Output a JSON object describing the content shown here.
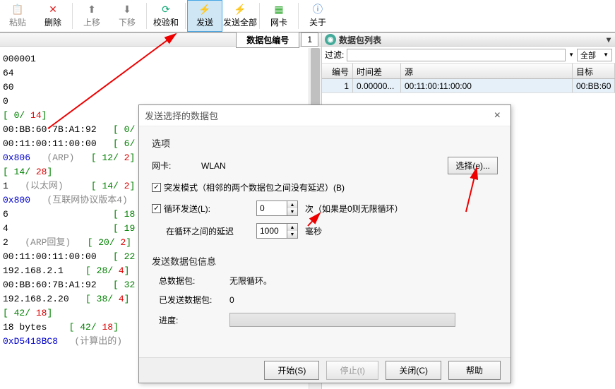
{
  "toolbar": {
    "paste": "粘贴",
    "delete": "删除",
    "moveup": "上移",
    "movedown": "下移",
    "checksum": "校验和",
    "send": "发送",
    "sendall": "发送全部",
    "nic": "网卡",
    "about": "关于"
  },
  "packet_bar": {
    "label": "数据包编号",
    "value": "1"
  },
  "hex_lines": [
    {
      "segs": [
        {
          "t": "000001",
          "c": "blk"
        }
      ]
    },
    {
      "segs": [
        {
          "t": "64",
          "c": "blk"
        }
      ]
    },
    {
      "segs": [
        {
          "t": "60",
          "c": "blk"
        }
      ]
    },
    {
      "segs": [
        {
          "t": "0",
          "c": "blk"
        }
      ]
    },
    {
      "segs": [
        {
          "t": "[ ",
          "c": "green"
        },
        {
          "t": "0",
          "c": "green"
        },
        {
          "t": "/ ",
          "c": "green"
        },
        {
          "t": "14",
          "c": "red"
        },
        {
          "t": "]",
          "c": "green"
        }
      ]
    },
    {
      "segs": [
        {
          "t": "00:BB:60:7B:A1:92   ",
          "c": "blk"
        },
        {
          "t": "[ ",
          "c": "green"
        },
        {
          "t": "0",
          "c": "green"
        },
        {
          "t": "/",
          "c": "green"
        }
      ]
    },
    {
      "segs": [
        {
          "t": "00:11:00:11:00:00   ",
          "c": "blk"
        },
        {
          "t": "[ ",
          "c": "green"
        },
        {
          "t": "6",
          "c": "green"
        },
        {
          "t": "/",
          "c": "green"
        }
      ]
    },
    {
      "segs": [
        {
          "t": "0x806   ",
          "c": "blue"
        },
        {
          "t": "(ARP)   ",
          "c": "gray"
        },
        {
          "t": "[ ",
          "c": "green"
        },
        {
          "t": "12",
          "c": "green"
        },
        {
          "t": "/ ",
          "c": "green"
        },
        {
          "t": "2",
          "c": "red"
        },
        {
          "t": "]",
          "c": "green"
        }
      ]
    },
    {
      "segs": [
        {
          "t": "[ ",
          "c": "green"
        },
        {
          "t": "14",
          "c": "green"
        },
        {
          "t": "/ ",
          "c": "green"
        },
        {
          "t": "28",
          "c": "red"
        },
        {
          "t": "]",
          "c": "green"
        }
      ]
    },
    {
      "segs": [
        {
          "t": "1   ",
          "c": "blk"
        },
        {
          "t": "(以太网)     ",
          "c": "gray"
        },
        {
          "t": "[ ",
          "c": "green"
        },
        {
          "t": "14",
          "c": "green"
        },
        {
          "t": "/ ",
          "c": "green"
        },
        {
          "t": "2",
          "c": "red"
        },
        {
          "t": "]",
          "c": "green"
        }
      ]
    },
    {
      "segs": [
        {
          "t": "0x800   ",
          "c": "blue"
        },
        {
          "t": "(互联网协议版本4)",
          "c": "gray"
        }
      ]
    },
    {
      "segs": [
        {
          "t": "6                   ",
          "c": "blk"
        },
        {
          "t": "[ ",
          "c": "green"
        },
        {
          "t": "18",
          "c": "green"
        }
      ]
    },
    {
      "segs": [
        {
          "t": "4                   ",
          "c": "blk"
        },
        {
          "t": "[ ",
          "c": "green"
        },
        {
          "t": "19",
          "c": "green"
        }
      ]
    },
    {
      "segs": [
        {
          "t": "2   ",
          "c": "blk"
        },
        {
          "t": "(ARP回复)   ",
          "c": "gray"
        },
        {
          "t": "[ ",
          "c": "green"
        },
        {
          "t": "20",
          "c": "green"
        },
        {
          "t": "/ ",
          "c": "green"
        },
        {
          "t": "2",
          "c": "red"
        },
        {
          "t": "]",
          "c": "green"
        }
      ]
    },
    {
      "segs": [
        {
          "t": "00:11:00:11:00:00   ",
          "c": "blk"
        },
        {
          "t": "[ ",
          "c": "green"
        },
        {
          "t": "22",
          "c": "green"
        }
      ]
    },
    {
      "segs": [
        {
          "t": "192.168.2.1    ",
          "c": "blk"
        },
        {
          "t": "[ ",
          "c": "green"
        },
        {
          "t": "28",
          "c": "green"
        },
        {
          "t": "/ ",
          "c": "green"
        },
        {
          "t": "4",
          "c": "red"
        },
        {
          "t": "]",
          "c": "green"
        }
      ]
    },
    {
      "segs": [
        {
          "t": "00:BB:60:7B:A1:92   ",
          "c": "blk"
        },
        {
          "t": "[ ",
          "c": "green"
        },
        {
          "t": "32",
          "c": "green"
        }
      ]
    },
    {
      "segs": [
        {
          "t": "192.168.2.20   ",
          "c": "blk"
        },
        {
          "t": "[ ",
          "c": "green"
        },
        {
          "t": "38",
          "c": "green"
        },
        {
          "t": "/ ",
          "c": "green"
        },
        {
          "t": "4",
          "c": "red"
        },
        {
          "t": "]",
          "c": "green"
        }
      ]
    },
    {
      "segs": [
        {
          "t": "[ ",
          "c": "green"
        },
        {
          "t": "42",
          "c": "green"
        },
        {
          "t": "/ ",
          "c": "green"
        },
        {
          "t": "18",
          "c": "red"
        },
        {
          "t": "]",
          "c": "green"
        }
      ]
    },
    {
      "segs": [
        {
          "t": "18 bytes    ",
          "c": "blk"
        },
        {
          "t": "[ ",
          "c": "green"
        },
        {
          "t": "42",
          "c": "green"
        },
        {
          "t": "/ ",
          "c": "green"
        },
        {
          "t": "18",
          "c": "red"
        },
        {
          "t": "]",
          "c": "green"
        }
      ]
    },
    {
      "segs": [
        {
          "t": "",
          "c": "blk"
        }
      ]
    },
    {
      "segs": [
        {
          "t": "0xD5418BC8   ",
          "c": "blue"
        },
        {
          "t": "(计算出的)",
          "c": "gray"
        }
      ]
    }
  ],
  "list_header": {
    "title": "数据包列表"
  },
  "filter": {
    "label": "过滤:",
    "all": "全部"
  },
  "grid": {
    "cols": {
      "num": "编号",
      "time": "时间差",
      "src": "源",
      "dst": "目标"
    },
    "row": {
      "num": "1",
      "time": "0.00000...",
      "src": "00:11:00:11:00:00",
      "dst": "00:BB:60"
    }
  },
  "dialog": {
    "title": "发送选择的数据包",
    "options_section": "选项",
    "nic_label": "网卡:",
    "nic_value": "WLAN",
    "select_btn": "选择(e)...",
    "burst_label": "突发模式（相邻的两个数据包之间没有延迟）(B)",
    "loop_label": "循环发送(L):",
    "loop_value": "0",
    "loop_suffix": "次（如果是0则无限循环）",
    "delay_label": "在循环之间的延迟",
    "delay_value": "1000",
    "delay_unit": "毫秒",
    "sendinfo_section": "发送数据包信息",
    "total_label": "总数据包:",
    "total_value": "无限循环。",
    "sent_label": "已发送数据包:",
    "sent_value": "0",
    "progress_label": "进度:",
    "start_btn": "开始(S)",
    "stop_btn": "停止(t)",
    "close_btn": "关闭(C)",
    "help_btn": "帮助"
  }
}
